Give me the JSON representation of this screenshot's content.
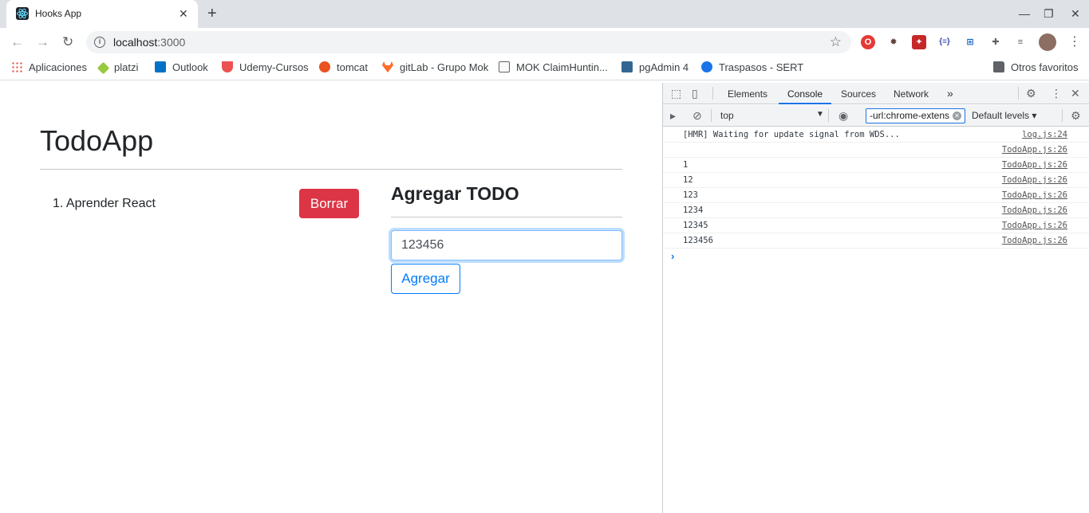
{
  "browser": {
    "tab_title": "Hooks App",
    "tab_close": "✕",
    "new_tab": "+",
    "url_host": "localhost",
    "url_port": ":3000",
    "window_controls": [
      "—",
      "❐",
      "✕"
    ]
  },
  "bookmarks": [
    {
      "label": "Aplicaciones",
      "icon": "apps-grid-icon",
      "color": "#ea4335"
    },
    {
      "label": "platzi",
      "icon": "platzi-icon",
      "color": "#98ca3f"
    },
    {
      "label": "Outlook",
      "icon": "outlook-icon",
      "color": "#0072c6"
    },
    {
      "label": "Udemy-Cursos",
      "icon": "udemy-icon",
      "color": "#ec5252"
    },
    {
      "label": "tomcat",
      "icon": "ubuntu-icon",
      "color": "#e95420"
    },
    {
      "label": "gitLab - Grupo Mok",
      "icon": "gitlab-icon",
      "color": "#fc6d26"
    },
    {
      "label": "MOK ClaimHuntin...",
      "icon": "page-icon",
      "color": "#5f6368"
    },
    {
      "label": "pgAdmin 4",
      "icon": "pgadmin-icon",
      "color": "#336791"
    },
    {
      "label": "Traspasos - SERT",
      "icon": "sert-icon",
      "color": "#1a73e8"
    },
    {
      "label": "Otros favoritos",
      "icon": "folder-icon",
      "color": "#5f6368"
    }
  ],
  "app": {
    "title": "TodoApp",
    "todos": [
      "1. Aprender React"
    ],
    "delete_label": "Borrar",
    "add_title": "Agregar TODO",
    "input_value": "123456",
    "add_label": "Agregar"
  },
  "devtools": {
    "tabs": [
      "Elements",
      "Console",
      "Sources",
      "Network"
    ],
    "active_tab": "Console",
    "more_tabs": "»",
    "context": "top",
    "filter_value": "-url:chrome-extens",
    "levels": "Default levels ▾",
    "logs": [
      {
        "message": "[HMR] Waiting for update signal from WDS...",
        "source": "log.js:24"
      },
      {
        "message": "",
        "source": "TodoApp.js:26"
      },
      {
        "message": "1",
        "source": "TodoApp.js:26"
      },
      {
        "message": "12",
        "source": "TodoApp.js:26"
      },
      {
        "message": "123",
        "source": "TodoApp.js:26"
      },
      {
        "message": "1234",
        "source": "TodoApp.js:26"
      },
      {
        "message": "12345",
        "source": "TodoApp.js:26"
      },
      {
        "message": "123456",
        "source": "TodoApp.js:26"
      }
    ],
    "prompt": "›"
  },
  "colors": {
    "danger": "#dc3545",
    "primary": "#007bff",
    "devtools_accent": "#1a73e8"
  }
}
